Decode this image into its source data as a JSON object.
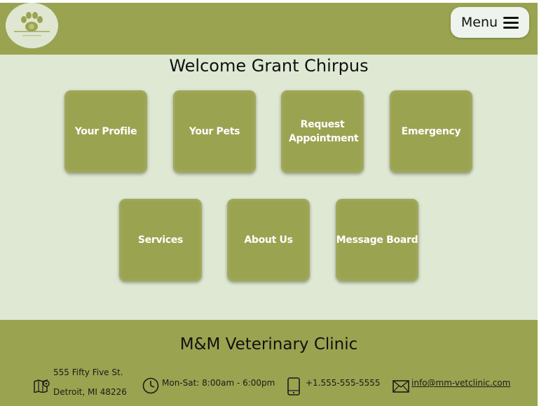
{
  "app": {
    "logo_name": "paw-logo",
    "accent_color": "#9aa350",
    "background_color": "#dfe8d3"
  },
  "header": {
    "menu_label": "Menu",
    "menu_icon": "hamburger-icon"
  },
  "main": {
    "welcome": "Welcome Grant Chirpus",
    "tiles": [
      {
        "label": "Your Profile"
      },
      {
        "label": "Your Pets"
      },
      {
        "label": "Request Appointment"
      },
      {
        "label": "Emergency"
      },
      {
        "label": "Services"
      },
      {
        "label": "About Us"
      },
      {
        "label": "Message Board"
      }
    ]
  },
  "footer": {
    "title": "M&M Veterinary Clinic",
    "address_line1": "555 Fifty Five St.",
    "address_line2": "Detroit, MI 48226",
    "hours": "Mon-Sat: 8:00am - 6:00pm",
    "phone": "+1.555-555-5555",
    "email": "info@mm-vetclinic.com",
    "icons": [
      "map-icon",
      "clock-icon",
      "phone-icon",
      "envelope-icon"
    ]
  }
}
